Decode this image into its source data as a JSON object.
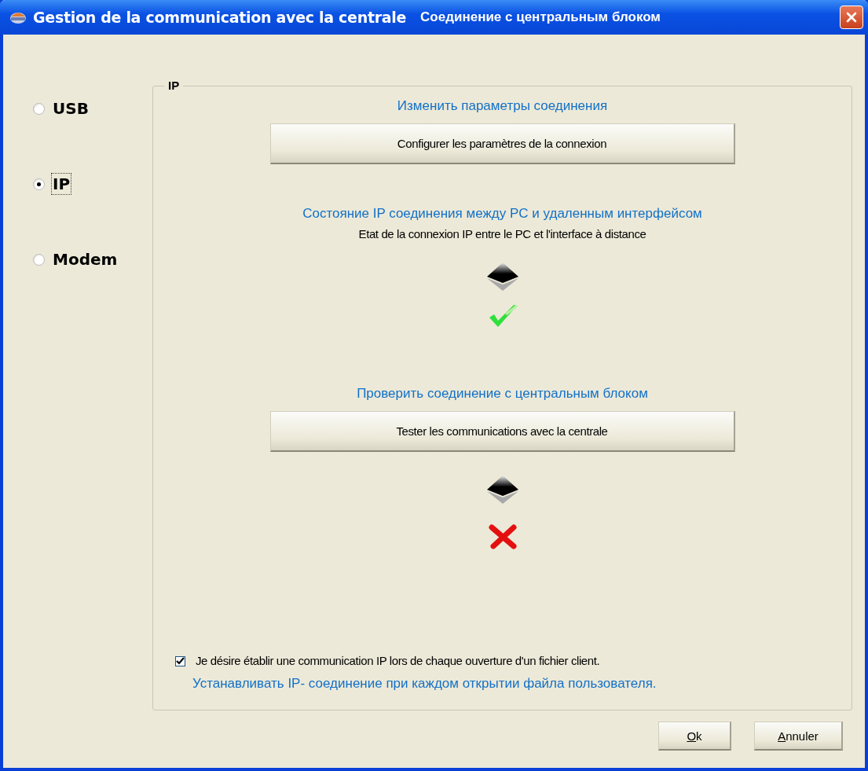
{
  "window": {
    "title": "Gestion de la communication avec la centrale",
    "title_translation": "Соединение с центральным блоком"
  },
  "connection_types": [
    {
      "label": "USB",
      "selected": false,
      "focused": false
    },
    {
      "label": "IP",
      "selected": true,
      "focused": true
    },
    {
      "label": "Modem",
      "selected": false,
      "focused": false
    }
  ],
  "group": {
    "title": "IP",
    "items": [
      {
        "kind": "translation",
        "text": "Изменить параметры соединения"
      },
      {
        "kind": "button",
        "text": "Configurer les paramètres de la connexion"
      },
      {
        "kind": "translation",
        "text": "Состояние IP соединения между PC и  удаленным интерфейсом"
      },
      {
        "kind": "caption",
        "text": "Etat de la connexion IP entre le PC et l'interface à distance"
      },
      {
        "kind": "arrow"
      },
      {
        "kind": "success"
      },
      {
        "kind": "translation",
        "text": "Проверить соединение с центральным блоком"
      },
      {
        "kind": "button",
        "text": "Tester les communications avec la centrale"
      },
      {
        "kind": "arrow"
      },
      {
        "kind": "failure"
      }
    ],
    "option": {
      "label": "Je désire établir une communication IP lors de chaque ouverture d'un fichier client.",
      "translation": "Устанавливать IP- соединение при каждом открытии файла пользователя.",
      "checked": true
    }
  },
  "buttons": [
    "Ok",
    "Annuler"
  ]
}
